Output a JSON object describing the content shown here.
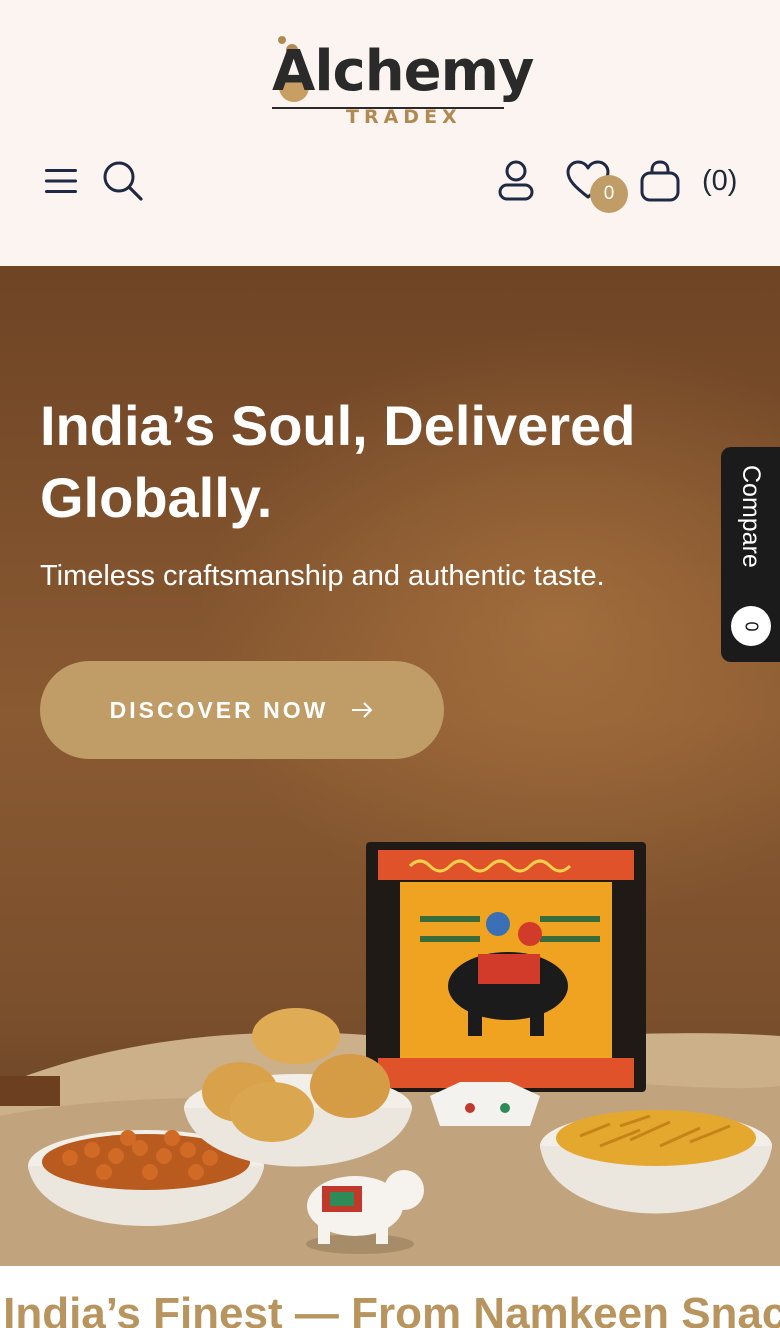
{
  "header": {
    "logo": {
      "name": "Alchemy",
      "sub": "TRADEX"
    },
    "icons": {
      "menu": "menu-icon",
      "search": "search-icon",
      "account": "user-icon",
      "wishlist": "heart-icon",
      "cart": "bag-icon"
    },
    "wishlist_count": "0",
    "cart_count": "(0)"
  },
  "hero": {
    "title": "India’s Soul, Delivered Globally.",
    "subtitle": "Timeless craftsmanship and authentic taste.",
    "cta_label": "DISCOVER NOW",
    "cta_icon": "arrow-right-icon"
  },
  "compare": {
    "label": "Compare",
    "count": "0"
  },
  "marquee": {
    "text": "g India’s Finest — From Namkeen Snack"
  },
  "colors": {
    "accent": "#c09c66",
    "page_bg": "#fcf4f0",
    "icon_navy": "#1e2a44",
    "compare_bg": "#1b1b1b",
    "marquee_text": "#b8955e"
  }
}
